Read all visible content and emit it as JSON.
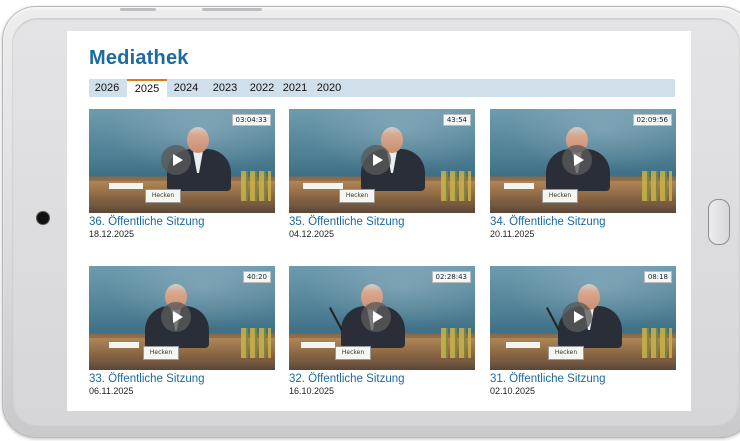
{
  "page": {
    "title": "Mediathek"
  },
  "tabs": [
    {
      "label": "2026",
      "active": false
    },
    {
      "label": "2025",
      "active": true
    },
    {
      "label": "2024",
      "active": false
    },
    {
      "label": "2023",
      "active": false
    },
    {
      "label": "2022",
      "active": false
    },
    {
      "label": "2021",
      "active": false
    },
    {
      "label": "2020",
      "active": false
    }
  ],
  "videos": [
    {
      "title": "36. Öffentliche Sitzung",
      "date": "18.12.2025",
      "duration": "03:04:33",
      "nameplate": "Hecken"
    },
    {
      "title": "35. Öffentliche Sitzung",
      "date": "04.12.2025",
      "duration": "43:54",
      "nameplate": "Hecken"
    },
    {
      "title": "34. Öffentliche Sitzung",
      "date": "20.11.2025",
      "duration": "02:09:56",
      "nameplate": "Hecken"
    },
    {
      "title": "33. Öffentliche Sitzung",
      "date": "06.11.2025",
      "duration": "40:20",
      "nameplate": "Hecken"
    },
    {
      "title": "32. Öffentliche Sitzung",
      "date": "16.10.2025",
      "duration": "02:28:43",
      "nameplate": "Hecken"
    },
    {
      "title": "31. Öffentliche Sitzung",
      "date": "02.10.2025",
      "duration": "08:18",
      "nameplate": "Hecken"
    }
  ],
  "icons": {
    "play": "play-icon",
    "camera": "camera-icon",
    "home": "home-button"
  }
}
